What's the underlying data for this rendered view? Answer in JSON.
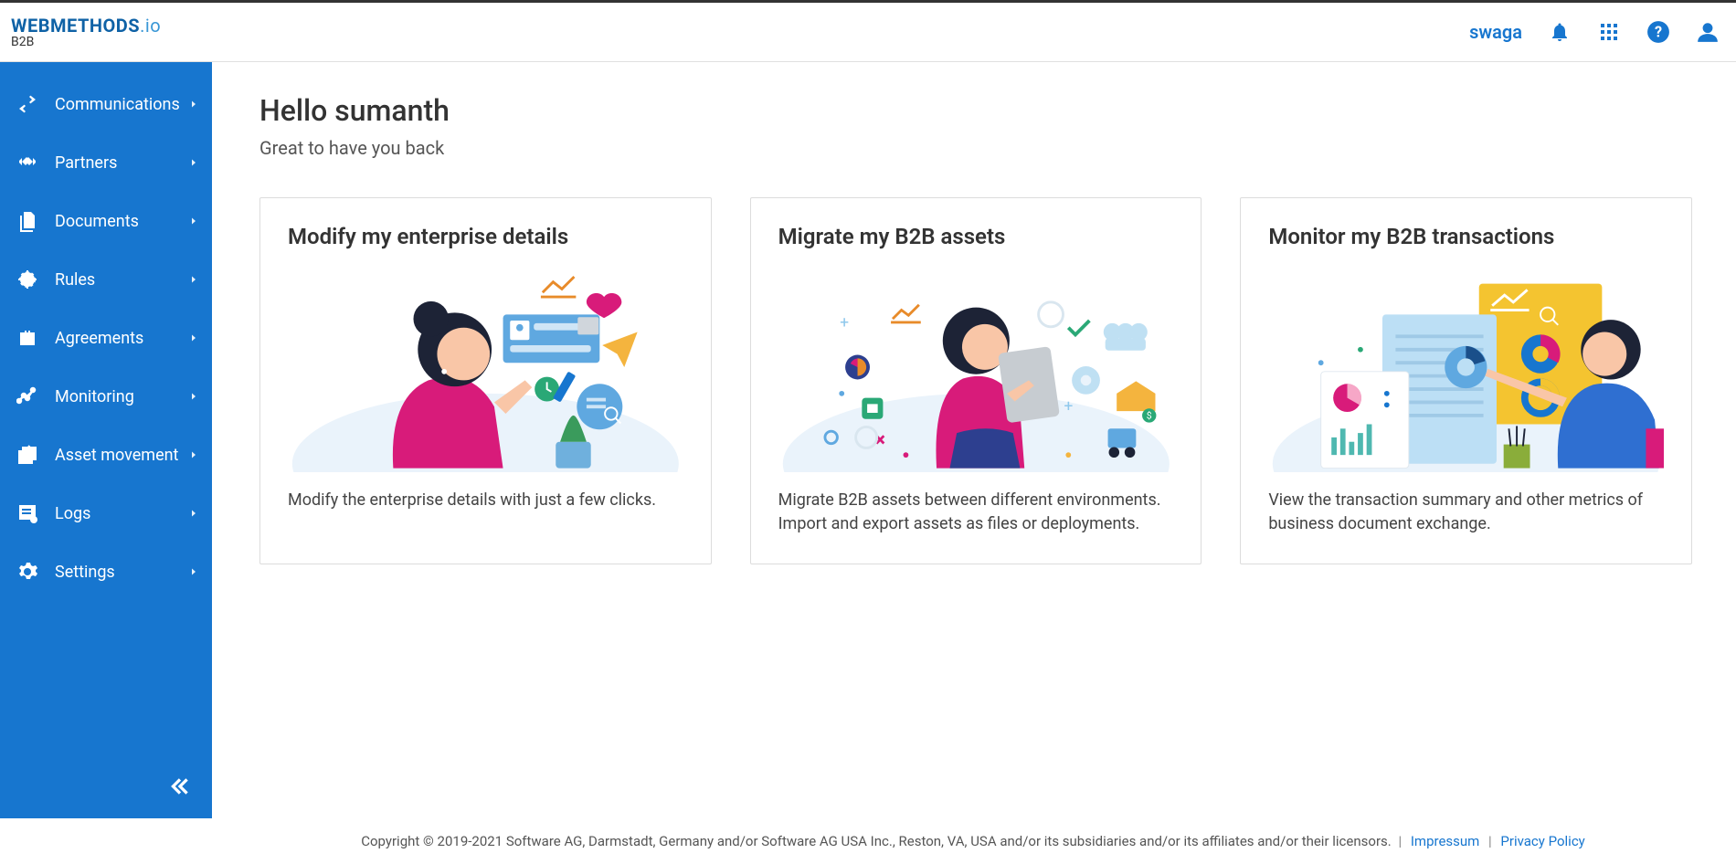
{
  "brand": {
    "main_left": "WEBMETHODS",
    "main_right": ".io",
    "sub": "B2B"
  },
  "header": {
    "user": "swaga"
  },
  "sidebar": {
    "items": [
      {
        "label": "Communications",
        "icon": "exchange"
      },
      {
        "label": "Partners",
        "icon": "handshake"
      },
      {
        "label": "Documents",
        "icon": "document"
      },
      {
        "label": "Rules",
        "icon": "target"
      },
      {
        "label": "Agreements",
        "icon": "briefcase"
      },
      {
        "label": "Monitoring",
        "icon": "chart"
      },
      {
        "label": "Asset movement",
        "icon": "move"
      },
      {
        "label": "Logs",
        "icon": "log"
      },
      {
        "label": "Settings",
        "icon": "gear"
      }
    ]
  },
  "main": {
    "greeting_title": "Hello sumanth",
    "greeting_sub": "Great to have you back",
    "cards": [
      {
        "title": "Modify my enterprise details",
        "desc": "Modify the enterprise details with just a few clicks."
      },
      {
        "title": "Migrate my B2B assets",
        "desc": "Migrate B2B assets between different environments. Import and export assets as files or deployments."
      },
      {
        "title": "Monitor my B2B transactions",
        "desc": "View the transaction summary and other metrics of business document exchange."
      }
    ]
  },
  "footer": {
    "copyright": "Copyright © 2019-2021 Software AG, Darmstadt, Germany and/or Software AG USA Inc., Reston, VA, USA and/or its subsidiaries and/or its affiliates and/or their licensors.",
    "links": [
      {
        "label": "Impressum"
      },
      {
        "label": "Privacy Policy"
      }
    ]
  }
}
